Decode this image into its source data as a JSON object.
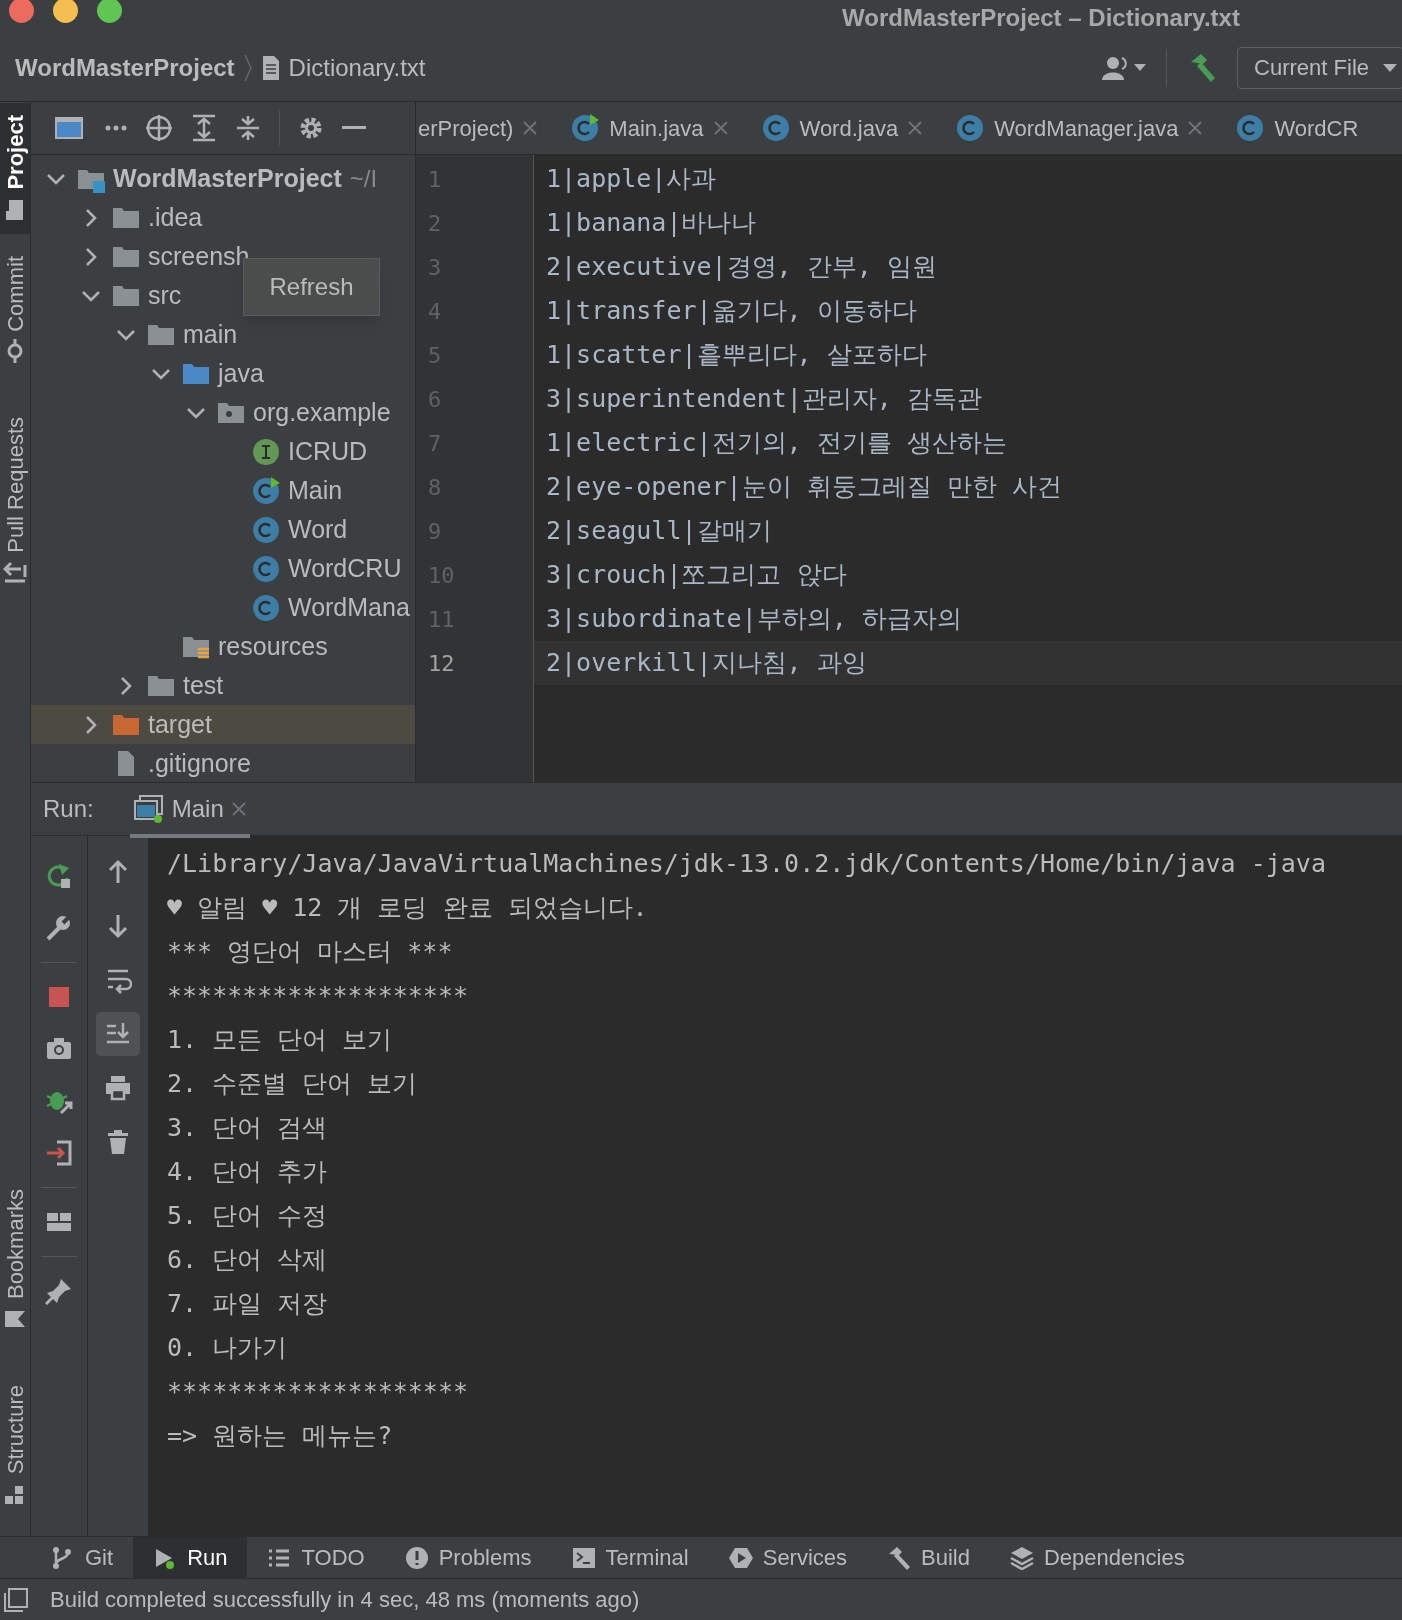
{
  "window": {
    "title": "WordMasterProject – Dictionary.txt"
  },
  "breadcrumb": [
    "WordMasterProject",
    "Dictionary.txt"
  ],
  "run_config": "Current File",
  "side_tabs": [
    {
      "label": "Project",
      "kind": "project",
      "selected": true
    },
    {
      "label": "Commit",
      "kind": "commit",
      "selected": false
    },
    {
      "label": "Pull Requests",
      "kind": "pull",
      "selected": false
    },
    {
      "label": "Bookmarks",
      "kind": "bookmark",
      "selected": false
    },
    {
      "label": "Structure",
      "kind": "structure",
      "selected": false
    }
  ],
  "project_tree": {
    "label": "WordMasterProject",
    "hint": "~/I",
    "kind": "module",
    "expanded": true,
    "selected": false,
    "children": [
      {
        "label": ".idea",
        "kind": "folder",
        "expanded": false,
        "selected": false
      },
      {
        "label": "screensh",
        "kind": "folder",
        "expanded": false,
        "selected": false
      },
      {
        "label": "src",
        "kind": "folder",
        "expanded": true,
        "selected": false,
        "children": [
          {
            "label": "main",
            "kind": "folder",
            "expanded": true,
            "selected": false,
            "children": [
              {
                "label": "java",
                "kind": "source",
                "expanded": true,
                "selected": false,
                "children": [
                  {
                    "label": "org.example",
                    "kind": "package",
                    "expanded": true,
                    "selected": false,
                    "children": [
                      {
                        "label": "ICRUD",
                        "kind": "interface",
                        "selected": false
                      },
                      {
                        "label": "Main",
                        "kind": "main_class",
                        "selected": false
                      },
                      {
                        "label": "Word",
                        "kind": "class",
                        "selected": false
                      },
                      {
                        "label": "WordCRU",
                        "kind": "class",
                        "selected": false
                      },
                      {
                        "label": "WordMana",
                        "kind": "class",
                        "selected": false
                      }
                    ]
                  }
                ]
              },
              {
                "label": "resources",
                "kind": "resources",
                "selected": false
              }
            ]
          },
          {
            "label": "test",
            "kind": "folder",
            "expanded": false,
            "selected": false
          }
        ]
      },
      {
        "label": "target",
        "kind": "excluded",
        "expanded": false,
        "selected": true
      },
      {
        "label": ".gitignore",
        "kind": "file",
        "selected": false
      }
    ]
  },
  "tooltip": "Refresh",
  "editor_tabs": [
    {
      "label": "erProject)",
      "kind": "text",
      "closable": true
    },
    {
      "label": "Main.java",
      "kind": "main_class",
      "closable": true
    },
    {
      "label": "Word.java",
      "kind": "class",
      "closable": true
    },
    {
      "label": "WordManager.java",
      "kind": "class",
      "closable": true
    },
    {
      "label": "WordCR",
      "kind": "class",
      "closable": false
    }
  ],
  "editor_lines": [
    {
      "number": "1",
      "text": "1|apple|사과",
      "current": false
    },
    {
      "number": "2",
      "text": "1|banana|바나나",
      "current": false
    },
    {
      "number": "3",
      "text": "2|executive|경영, 간부, 임원",
      "current": false
    },
    {
      "number": "4",
      "text": "1|transfer|옮기다, 이동하다",
      "current": false
    },
    {
      "number": "5",
      "text": "1|scatter|흩뿌리다, 살포하다",
      "current": false
    },
    {
      "number": "6",
      "text": "3|superintendent|관리자, 감독관",
      "current": false
    },
    {
      "number": "7",
      "text": "1|electric|전기의, 전기를 생산하는",
      "current": false
    },
    {
      "number": "8",
      "text": "2|eye-opener|눈이 휘둥그레질 만한 사건",
      "current": false
    },
    {
      "number": "9",
      "text": "2|seagull|갈매기",
      "current": false
    },
    {
      "number": "10",
      "text": "3|crouch|쪼그리고 앉다",
      "current": false
    },
    {
      "number": "11",
      "text": "3|subordinate|부하의, 하급자의",
      "current": false
    },
    {
      "number": "12",
      "text": "2|overkill|지나침, 과잉",
      "current": true
    }
  ],
  "run": {
    "label": "Run:",
    "tab": "Main"
  },
  "run_toolbar": [
    {
      "kind": "rerun"
    },
    {
      "kind": "wrench"
    },
    {
      "kind": "sep"
    },
    {
      "kind": "stop"
    },
    {
      "kind": "camera"
    },
    {
      "kind": "debug"
    },
    {
      "kind": "exit"
    },
    {
      "kind": "sep"
    },
    {
      "kind": "layout"
    },
    {
      "kind": "sep"
    },
    {
      "kind": "pin"
    }
  ],
  "console_toolbar": [
    {
      "kind": "up",
      "on": false
    },
    {
      "kind": "down",
      "on": false
    },
    {
      "kind": "wrap",
      "on": false
    },
    {
      "kind": "scroll_end",
      "on": true
    },
    {
      "kind": "print",
      "on": false
    },
    {
      "kind": "trash",
      "on": false
    }
  ],
  "console_lines": [
    "/Library/Java/JavaVirtualMachines/jdk-13.0.2.jdk/Contents/Home/bin/java -java",
    "♥ 알림 ♥ 12 개 로딩 완료 되었습니다.",
    "*** 영단어 마스터 ***",
    "********************",
    "1. 모든 단어 보기",
    "2. 수준별 단어 보기",
    "3. 단어 검색",
    "4. 단어 추가",
    "5. 단어 수정",
    "6. 단어 삭제",
    "7. 파일 저장",
    "0. 나가기",
    "********************",
    "=> 원하는 메뉴는?"
  ],
  "tool_windows": [
    {
      "label": "Git",
      "kind": "git",
      "selected": false
    },
    {
      "label": "Run",
      "kind": "run",
      "selected": true
    },
    {
      "label": "TODO",
      "kind": "todo",
      "selected": false
    },
    {
      "label": "Problems",
      "kind": "problems",
      "selected": false
    },
    {
      "label": "Terminal",
      "kind": "terminal",
      "selected": false
    },
    {
      "label": "Services",
      "kind": "services",
      "selected": false
    },
    {
      "label": "Build",
      "kind": "build",
      "selected": false
    },
    {
      "label": "Dependencies",
      "kind": "dependencies",
      "selected": false
    }
  ],
  "status": "Build completed successfully in 4 sec, 48 ms (moments ago)"
}
